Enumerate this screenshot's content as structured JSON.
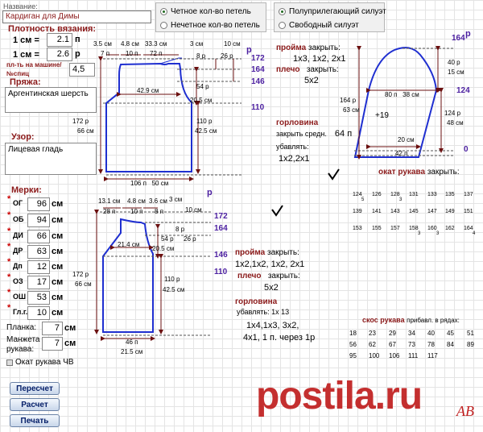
{
  "header": {
    "name_label": "Название:",
    "name_value": "Кардиган для Димы"
  },
  "loop_type": {
    "opt1": "Четное кол-во петель",
    "opt2": "Нечетное кол-во петель"
  },
  "silhouette": {
    "opt1": "Полуприлегающий силуэт",
    "opt2": "Свободный силуэт"
  },
  "gauge": {
    "title": "Плотность вязания:",
    "row1_label": "1 см =",
    "row1_value": "2.1",
    "row1_unit": "п",
    "row2_label": "1 см =",
    "row2_value": "2.6",
    "row2_unit": "р",
    "needle_label1": "пл-ть на машине/",
    "needle_label2": "№спиц",
    "needle_value": "4,5"
  },
  "yarn": {
    "title": "Пряжа:",
    "value": "Аргентинская шерсть"
  },
  "pattern": {
    "title": "Узор:",
    "value": "Лицевая гладь"
  },
  "measures": {
    "title": "Мерки:",
    "items": [
      {
        "label": "ОГ",
        "value": "96",
        "unit": "см"
      },
      {
        "label": "ОБ",
        "value": "94",
        "unit": "см"
      },
      {
        "label": "ДИ",
        "value": "66",
        "unit": "см"
      },
      {
        "label": "ДР",
        "value": "63",
        "unit": "см"
      },
      {
        "label": "Дп",
        "value": "12",
        "unit": "см"
      },
      {
        "label": "ОЗ",
        "value": "17",
        "unit": "см"
      },
      {
        "label": "ОШ",
        "value": "53",
        "unit": "см"
      },
      {
        "label": "Гл.г.",
        "value": "10",
        "unit": "см"
      }
    ],
    "plank_label": "Планка:",
    "plank_value": "7",
    "plank_unit": "см",
    "cuff_label1": "Манжета",
    "cuff_label2": "рукава:",
    "cuff_value": "7",
    "cuff_unit": "см",
    "sleeve_cb_label": "Окат рукава ЧВ"
  },
  "buttons": {
    "recalc": "Пересчет",
    "calc": "Расчет",
    "print": "Печать"
  },
  "back": {
    "top": [
      "3.5",
      "см",
      "4.8",
      "см",
      "33.3",
      "см",
      "3",
      "см",
      "10",
      "см"
    ],
    "top2": [
      "7",
      "п",
      "10",
      "п",
      "72",
      "п",
      "8",
      "р",
      "26",
      "р"
    ],
    "right_nums": [
      "172",
      "164",
      "146",
      "110"
    ],
    "p_label": "р",
    "mid": [
      "42.9",
      "см"
    ],
    "side1": [
      "54",
      "р",
      "20.5",
      "см"
    ],
    "side2": [
      "110",
      "р",
      "42.5",
      "см"
    ],
    "left": [
      "172",
      "р",
      "66",
      "см"
    ],
    "bottom": [
      "106",
      "п",
      "50",
      "см"
    ]
  },
  "notes_back": {
    "armhole_t": "пройма",
    "armhole_close": "закрыть:",
    "armhole_vals": "1х3, 1х2, 2х1",
    "shoulder_t": "плечо",
    "shoulder_close": "закрыть:",
    "shoulder_vals": "5х2",
    "neck_t": "горловина",
    "neck_close": "закрыть средн.",
    "neck_close_val": "64 п",
    "neck_dec": "убавлять:",
    "neck_dec_vals": "1х2,2х1"
  },
  "sleeve": {
    "top_label": "164",
    "p_label": "р",
    "right": [
      "40",
      "р",
      "15",
      "см",
      "124",
      "124",
      "р",
      "48",
      "см",
      "0"
    ],
    "left": [
      "164",
      "р",
      "63",
      "см"
    ],
    "inner": [
      "80",
      "п",
      "38",
      "см",
      "+19",
      "20",
      "см",
      "42",
      "п"
    ],
    "cap_title": "окат рукава",
    "cap_close": "закрыть:"
  },
  "cap_table": {
    "row1": [
      "124",
      "126",
      "128",
      "131",
      "133",
      "135",
      "137"
    ],
    "row1_sub": [
      "5",
      "",
      "3",
      "",
      "",
      "",
      ""
    ],
    "row2": [
      "139",
      "141",
      "143",
      "145",
      "147",
      "149",
      "151"
    ],
    "row3": [
      "153",
      "155",
      "157",
      "158",
      "160",
      "162",
      "164"
    ],
    "row3_sub": [
      "",
      "",
      "",
      "3",
      "3",
      "",
      "4"
    ]
  },
  "front": {
    "top": [
      "13.1",
      "см",
      "4.8",
      "см",
      "3.6",
      "см"
    ],
    "top2": [
      "28",
      "п",
      "10",
      "п",
      "8",
      "п"
    ],
    "right_top": [
      "3",
      "см",
      "10",
      "см"
    ],
    "right_nums": [
      "172",
      "164",
      "146",
      "110"
    ],
    "p_label": "р",
    "mid": [
      "21.4",
      "см"
    ],
    "side1": [
      "54",
      "р",
      "20.5",
      "см"
    ],
    "side1b": [
      "8",
      "р",
      "26",
      "р"
    ],
    "side2": [
      "110",
      "р",
      "42.5",
      "см"
    ],
    "left": [
      "172",
      "р",
      "66",
      "см"
    ],
    "bottom": [
      "46",
      "п",
      "21.5",
      "см"
    ]
  },
  "notes_front": {
    "armhole_t": "пройма",
    "armhole_close": "закрыть:",
    "armhole_vals": "1х2,1х2, 1х2, 2х1",
    "shoulder_t": "плечо",
    "shoulder_close": "закрыть:",
    "shoulder_vals": "5х2",
    "neck_t": "горловина",
    "neck_dec": "убавлять: 1х 13",
    "neck_line1": "1х4,1х3, 3х2,",
    "neck_line2": "4х1, 1 п. через 1р"
  },
  "sleeve_slope": {
    "title": "скос рукава",
    "subtitle": "прибавл. в рядах:",
    "row1": [
      "18",
      "23",
      "29",
      "34",
      "40",
      "45",
      "51"
    ],
    "row2": [
      "56",
      "62",
      "67",
      "73",
      "78",
      "84",
      "89"
    ],
    "row3": [
      "95",
      "100",
      "106",
      "111",
      "117"
    ]
  },
  "watermark": {
    "text": "postila.ru",
    "sig": "AB"
  },
  "colors": {
    "accent_blue": "#1f2fd0",
    "label_maroon": "#8b1a1a",
    "nums_purple": "#4b1fa0",
    "watermark_red": "#c02020"
  }
}
